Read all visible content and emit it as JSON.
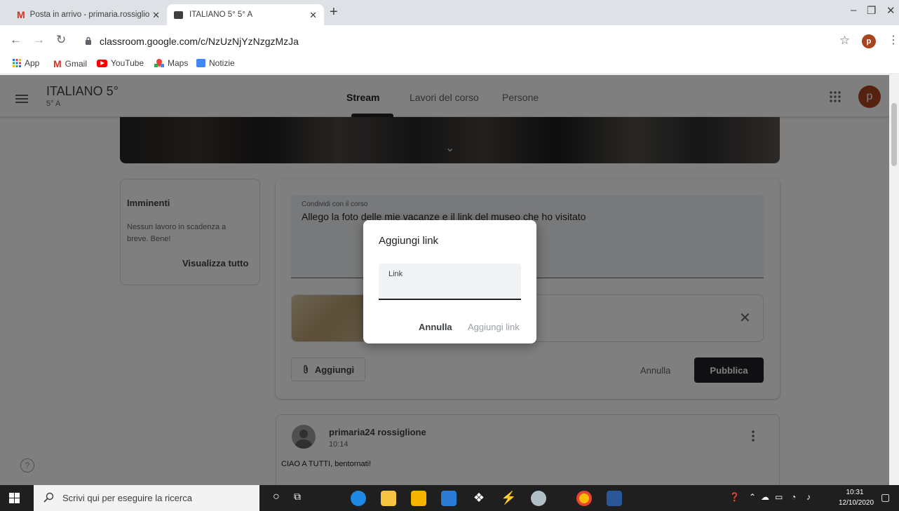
{
  "browser": {
    "tabs": [
      {
        "title": "Posta in arrivo - primaria.rossiglio"
      },
      {
        "title": "ITALIANO 5° 5° A"
      }
    ],
    "url": "classroom.google.com/c/NzUzNjYzNzgzMzJa",
    "profile_initial": "p",
    "bookmarks": [
      "App",
      "Gmail",
      "YouTube",
      "Maps",
      "Notizie"
    ]
  },
  "classroom": {
    "course_title": "ITALIANO 5°",
    "course_section": "5° A",
    "nav_tabs": [
      "Stream",
      "Lavori del corso",
      "Persone"
    ],
    "user_initial": "p",
    "upcoming": {
      "title": "Imminenti",
      "message": "Nessun lavoro in scadenza a breve. Bene!",
      "view_all": "Visualizza tutto"
    },
    "compose": {
      "label": "Condividi con il corso",
      "text": "Allego la foto delle mie vacanze e il link del museo che ho visitato",
      "add_label": "Aggiungi",
      "cancel_label": "Annulla",
      "publish_label": "Pubblica"
    },
    "post": {
      "author": "primaria24 rossiglione",
      "time": "10:14",
      "body": "CIAO A TUTTI, bentornati!"
    },
    "help": "?"
  },
  "dialog": {
    "title": "Aggiungi link",
    "field_label": "Link",
    "field_value": "",
    "cancel_label": "Annulla",
    "confirm_label": "Aggiungi link"
  },
  "taskbar": {
    "search_placeholder": "Scrivi qui per eseguire la ricerca",
    "time": "10:31",
    "date": "12/10/2020"
  },
  "colors": {
    "accent_dark": "#202124",
    "avatar": "#a8441f",
    "scrim": "rgba(0,0,0,0.5)"
  }
}
